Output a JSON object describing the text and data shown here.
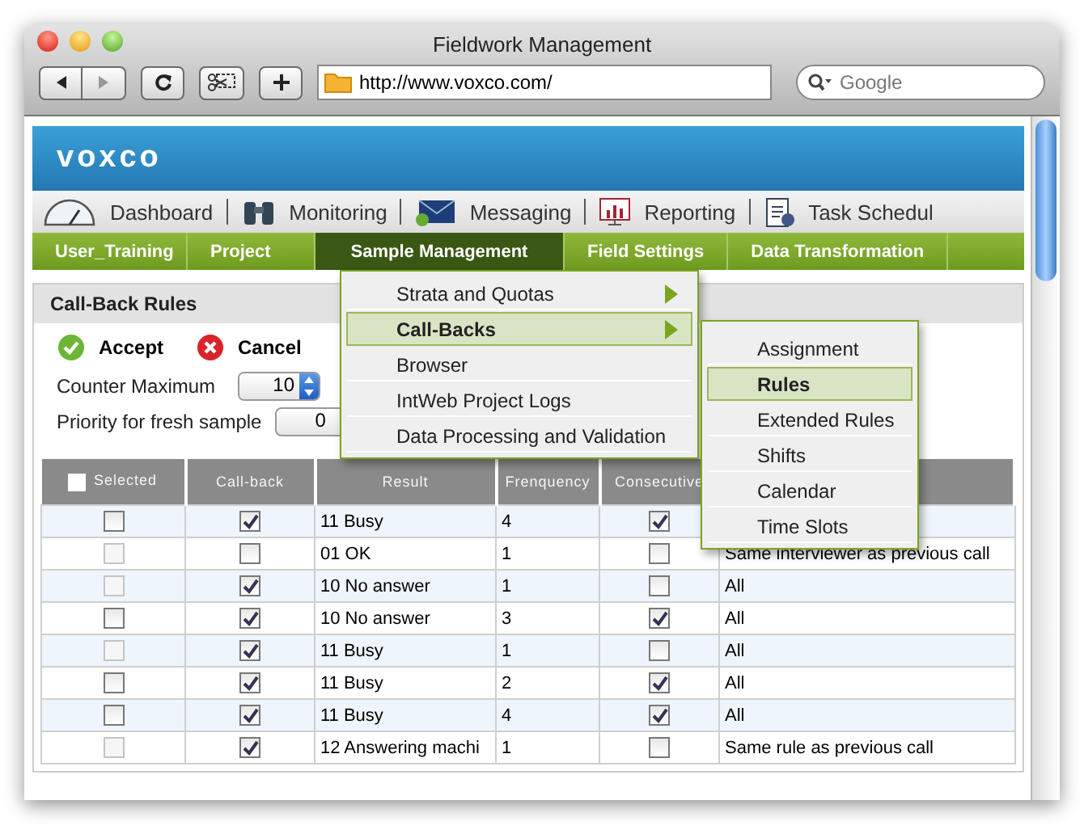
{
  "window": {
    "title": "Fieldwork Management",
    "url": "http://www.voxco.com/",
    "search_placeholder": "Google"
  },
  "logo": "voxco",
  "modules": [
    {
      "label": "Dashboard",
      "kind": "gauge"
    },
    {
      "label": "Monitoring",
      "kind": "binoculars"
    },
    {
      "label": "Messaging",
      "kind": "envelope"
    },
    {
      "label": "Reporting",
      "kind": "chart"
    },
    {
      "label": "Task Schedul",
      "kind": "clipboard"
    }
  ],
  "nav": [
    {
      "label": "User_Training",
      "selected": false
    },
    {
      "label": "Project",
      "selected": false
    },
    {
      "label": "Sample Management",
      "selected": true
    },
    {
      "label": "Field Settings",
      "selected": false
    },
    {
      "label": "Data Transformation",
      "selected": false
    }
  ],
  "menu": [
    {
      "label": "Strata and Quotas",
      "selected": false,
      "has_submenu": true
    },
    {
      "label": "Call-Backs",
      "selected": true,
      "has_submenu": true
    },
    {
      "label": "Browser",
      "selected": false,
      "has_submenu": false
    },
    {
      "label": "IntWeb Project Logs",
      "selected": false,
      "has_submenu": false
    },
    {
      "label": "Data Processing and Validation",
      "selected": false,
      "has_submenu": false
    }
  ],
  "submenu": [
    {
      "label": "Assignment",
      "selected": false
    },
    {
      "label": "Rules",
      "selected": true
    },
    {
      "label": "Extended Rules",
      "selected": false
    },
    {
      "label": "Shifts",
      "selected": false
    },
    {
      "label": "Calendar",
      "selected": false
    },
    {
      "label": "Time Slots",
      "selected": false
    }
  ],
  "panel": {
    "title": "Call-Back Rules",
    "accept": "Accept",
    "cancel": "Cancel",
    "counter_maximum": {
      "label": "Counter Maximum",
      "value": "10"
    },
    "priority": {
      "label": "Priority for fresh sample",
      "value": "0"
    }
  },
  "table": {
    "select_all": false,
    "columns": [
      "Selected",
      "Call-back",
      "Result",
      "Frenquency",
      "Consecutive"
    ],
    "rows": [
      {
        "selected": false,
        "disabled": false,
        "callback": true,
        "result": "11 Busy",
        "frequency": "4",
        "consecutive": true
      },
      {
        "selected": false,
        "disabled": true,
        "callback": false,
        "result": "01 OK",
        "frequency": "1",
        "consecutive": false,
        "column_6": "Same interviewer as previous call"
      },
      {
        "selected": false,
        "disabled": true,
        "callback": true,
        "result": "10 No answer",
        "frequency": "1",
        "consecutive": false,
        "column_6": "All"
      },
      {
        "selected": false,
        "disabled": false,
        "callback": true,
        "result": "10 No answer",
        "frequency": "3",
        "consecutive": true,
        "column_6": "All"
      },
      {
        "selected": false,
        "disabled": true,
        "callback": true,
        "result": "11 Busy",
        "frequency": "1",
        "consecutive": false,
        "column_6": "All"
      },
      {
        "selected": false,
        "disabled": false,
        "callback": true,
        "result": "11 Busy",
        "frequency": "2",
        "consecutive": true,
        "column_6": "All"
      },
      {
        "selected": false,
        "disabled": false,
        "callback": true,
        "result": "11 Busy",
        "frequency": "4",
        "consecutive": true,
        "column_6": "All"
      },
      {
        "selected": false,
        "disabled": true,
        "callback": true,
        "result": "12 Answering machi",
        "frequency": "1",
        "consecutive": false,
        "column_6": "Same rule as previous call"
      }
    ]
  }
}
